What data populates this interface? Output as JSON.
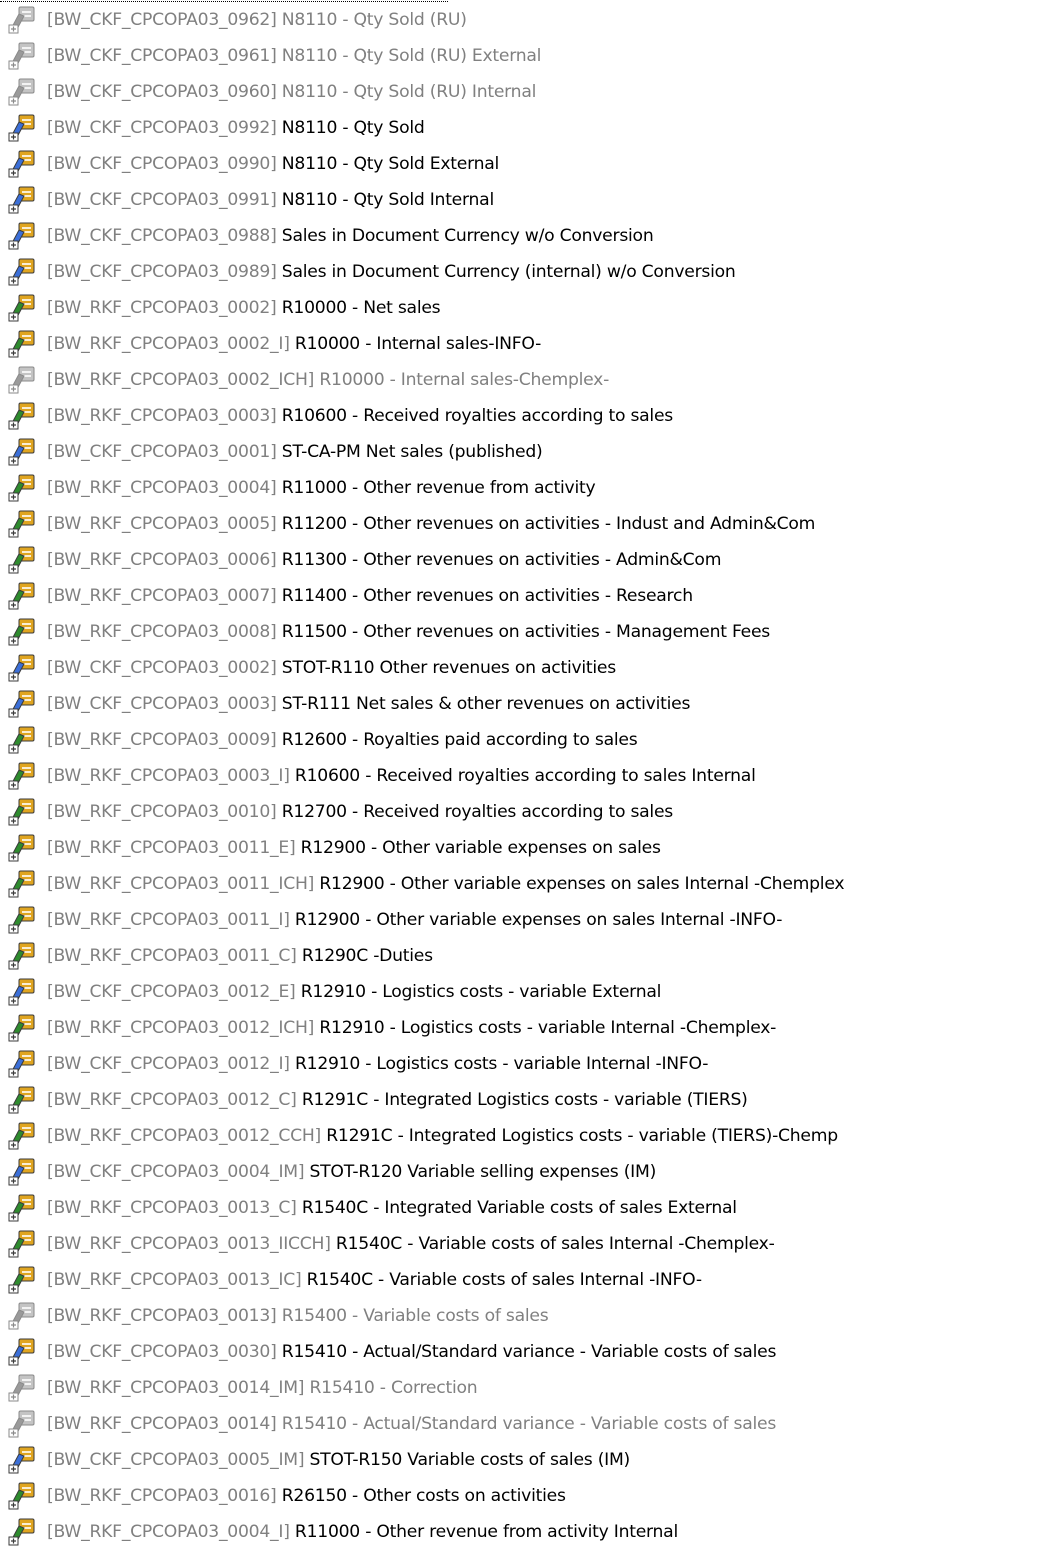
{
  "colors": {
    "technical_name": "#808080",
    "active_description": "#000000",
    "inactive_description": "#808080",
    "ckf_icon_blue": "#3b6fd8",
    "rkf_icon_green": "#2e8b2e",
    "icon_gold": "#e0a520",
    "inactive_icon": "#9a9a9a"
  },
  "items": [
    {
      "tech": "[BW_CKF_CPCOPA03_0962]",
      "desc": "N8110 - Qty Sold (RU)",
      "kind": "ckf",
      "active": false
    },
    {
      "tech": "[BW_CKF_CPCOPA03_0961]",
      "desc": "N8110 - Qty Sold (RU) External",
      "kind": "ckf",
      "active": false
    },
    {
      "tech": "[BW_CKF_CPCOPA03_0960]",
      "desc": "N8110 - Qty Sold (RU) Internal",
      "kind": "ckf",
      "active": false
    },
    {
      "tech": "[BW_CKF_CPCOPA03_0992]",
      "desc": "N8110 - Qty Sold",
      "kind": "ckf",
      "active": true
    },
    {
      "tech": "[BW_CKF_CPCOPA03_0990]",
      "desc": "N8110 - Qty Sold External",
      "kind": "ckf",
      "active": true
    },
    {
      "tech": "[BW_CKF_CPCOPA03_0991]",
      "desc": "N8110 - Qty Sold Internal",
      "kind": "ckf",
      "active": true
    },
    {
      "tech": "[BW_CKF_CPCOPA03_0988]",
      "desc": "Sales in Document Currency w/o Conversion",
      "kind": "ckf",
      "active": true
    },
    {
      "tech": "[BW_CKF_CPCOPA03_0989]",
      "desc": "Sales in Document Currency (internal)  w/o Conversion",
      "kind": "ckf",
      "active": true
    },
    {
      "tech": "[BW_RKF_CPCOPA03_0002]",
      "desc": "R10000 - Net sales",
      "kind": "rkf",
      "active": true
    },
    {
      "tech": "[BW_RKF_CPCOPA03_0002_I]",
      "desc": "R10000 - Internal sales-INFO-",
      "kind": "rkf",
      "active": true
    },
    {
      "tech": "[BW_RKF_CPCOPA03_0002_ICH]",
      "desc": "R10000 - Internal sales-Chemplex-",
      "kind": "rkf",
      "active": false
    },
    {
      "tech": "[BW_RKF_CPCOPA03_0003]",
      "desc": "R10600 - Received royalties according to sales",
      "kind": "rkf",
      "active": true
    },
    {
      "tech": "[BW_CKF_CPCOPA03_0001]",
      "desc": "ST-CA-PM Net sales (published)",
      "kind": "ckf",
      "active": true
    },
    {
      "tech": "[BW_RKF_CPCOPA03_0004]",
      "desc": "R11000 - Other revenue from activity",
      "kind": "rkf",
      "active": true
    },
    {
      "tech": "[BW_RKF_CPCOPA03_0005]",
      "desc": "R11200 - Other revenues on activities - Indust and Admin&Com",
      "kind": "rkf",
      "active": true
    },
    {
      "tech": "[BW_RKF_CPCOPA03_0006]",
      "desc": "R11300 - Other revenues on activities - Admin&Com",
      "kind": "rkf",
      "active": true
    },
    {
      "tech": "[BW_RKF_CPCOPA03_0007]",
      "desc": "R11400 - Other revenues on activities - Research",
      "kind": "rkf",
      "active": true
    },
    {
      "tech": "[BW_RKF_CPCOPA03_0008]",
      "desc": "R11500 - Other revenues on activities - Management Fees",
      "kind": "rkf",
      "active": true
    },
    {
      "tech": "[BW_CKF_CPCOPA03_0002]",
      "desc": "STOT-R110 Other revenues on activities",
      "kind": "ckf",
      "active": true
    },
    {
      "tech": "[BW_CKF_CPCOPA03_0003]",
      "desc": "ST-R111 Net sales & other revenues on activities",
      "kind": "ckf",
      "active": true
    },
    {
      "tech": "[BW_RKF_CPCOPA03_0009]",
      "desc": "R12600 - Royalties paid according to sales",
      "kind": "rkf",
      "active": true
    },
    {
      "tech": "[BW_RKF_CPCOPA03_0003_I]",
      "desc": "R10600 - Received royalties according to sales Internal",
      "kind": "rkf",
      "active": true
    },
    {
      "tech": "[BW_RKF_CPCOPA03_0010]",
      "desc": "R12700 - Received royalties according to sales",
      "kind": "rkf",
      "active": true
    },
    {
      "tech": "[BW_RKF_CPCOPA03_0011_E]",
      "desc": "R12900 - Other variable expenses on sales",
      "kind": "rkf",
      "active": true
    },
    {
      "tech": "[BW_RKF_CPCOPA03_0011_ICH]",
      "desc": "R12900 - Other variable expenses on sales Internal -Chemplex",
      "kind": "rkf",
      "active": true
    },
    {
      "tech": "[BW_RKF_CPCOPA03_0011_I]",
      "desc": "R12900 - Other variable expenses on sales Internal -INFO-",
      "kind": "rkf",
      "active": true
    },
    {
      "tech": "[BW_RKF_CPCOPA03_0011_C]",
      "desc": "R1290C -Duties",
      "kind": "rkf",
      "active": true
    },
    {
      "tech": "[BW_CKF_CPCOPA03_0012_E]",
      "desc": "R12910 - Logistics costs - variable External",
      "kind": "ckf",
      "active": true
    },
    {
      "tech": "[BW_RKF_CPCOPA03_0012_ICH]",
      "desc": "R12910 - Logistics costs - variable Internal -Chemplex-",
      "kind": "rkf",
      "active": true
    },
    {
      "tech": "[BW_CKF_CPCOPA03_0012_I]",
      "desc": "R12910 - Logistics costs - variable Internal -INFO-",
      "kind": "ckf",
      "active": true
    },
    {
      "tech": "[BW_RKF_CPCOPA03_0012_C]",
      "desc": "R1291C - Integrated Logistics costs - variable (TIERS)",
      "kind": "rkf",
      "active": true
    },
    {
      "tech": "[BW_RKF_CPCOPA03_0012_CCH]",
      "desc": "R1291C - Integrated Logistics costs - variable (TIERS)-Chemp",
      "kind": "rkf",
      "active": true
    },
    {
      "tech": "[BW_CKF_CPCOPA03_0004_IM]",
      "desc": "STOT-R120 Variable selling expenses (IM)",
      "kind": "ckf",
      "active": true
    },
    {
      "tech": "[BW_RKF_CPCOPA03_0013_C]",
      "desc": "R1540C - Integrated Variable costs of sales External",
      "kind": "rkf",
      "active": true
    },
    {
      "tech": "[BW_RKF_CPCOPA03_0013_IICCH]",
      "desc": "R1540C - Variable costs of sales Internal -Chemplex-",
      "kind": "rkf",
      "active": true
    },
    {
      "tech": "[BW_RKF_CPCOPA03_0013_IC]",
      "desc": "R1540C - Variable costs of sales Internal -INFO-",
      "kind": "rkf",
      "active": true
    },
    {
      "tech": "[BW_RKF_CPCOPA03_0013]",
      "desc": "R15400 - Variable costs of sales",
      "kind": "rkf",
      "active": false
    },
    {
      "tech": "[BW_CKF_CPCOPA03_0030]",
      "desc": "R15410 - Actual/Standard variance - Variable costs of sales",
      "kind": "ckf",
      "active": true
    },
    {
      "tech": "[BW_RKF_CPCOPA03_0014_IM]",
      "desc": "R15410 - Correction",
      "kind": "rkf",
      "active": false
    },
    {
      "tech": "[BW_RKF_CPCOPA03_0014]",
      "desc": "R15410 - Actual/Standard variance - Variable costs of sales",
      "kind": "rkf",
      "active": false
    },
    {
      "tech": "[BW_CKF_CPCOPA03_0005_IM]",
      "desc": "STOT-R150 Variable costs of sales (IM)",
      "kind": "ckf",
      "active": true
    },
    {
      "tech": "[BW_RKF_CPCOPA03_0016]",
      "desc": "R26150 - Other costs on activities",
      "kind": "rkf",
      "active": true
    },
    {
      "tech": "[BW_RKF_CPCOPA03_0004_I]",
      "desc": "R11000 - Other revenue from activity Internal",
      "kind": "rkf",
      "active": true
    }
  ]
}
